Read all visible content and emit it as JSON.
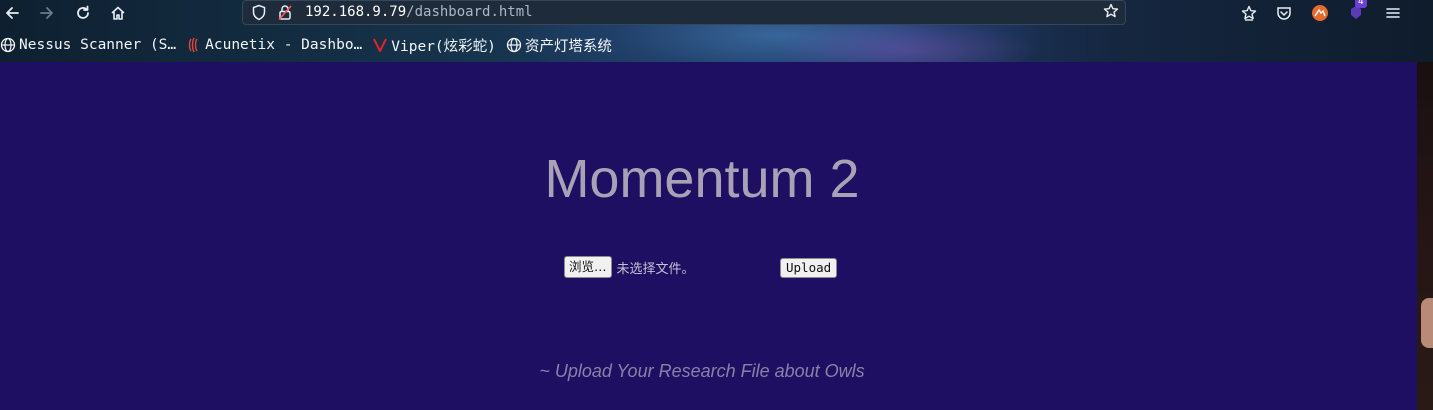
{
  "browser": {
    "url_host": "192.168.9.79",
    "url_path": "/dashboard.html",
    "extensions_badge": "4",
    "icons": [
      "back-arrow-icon",
      "forward-arrow-icon",
      "reload-icon",
      "home-icon",
      "shield-icon",
      "lock-icon",
      "star-icon",
      "save-to-pocket-icon",
      "pocket-icon",
      "extension-icon",
      "hamburger-menu-icon"
    ]
  },
  "bookmarks": [
    {
      "label": "Nessus Scanner (S…",
      "icon": "globe-icon"
    },
    {
      "label": "Acunetix - Dashbo…",
      "icon": "acunetix-icon"
    },
    {
      "label": "Viper(炫彩蛇)",
      "icon": "viper-icon"
    },
    {
      "label": "资产灯塔系统",
      "icon": "globe-icon"
    }
  ],
  "page": {
    "title": "Momentum 2",
    "browse_button": "浏览…",
    "file_status": "未选择文件。",
    "upload_button": "Upload",
    "caption": "~ Upload Your Research File about Owls"
  },
  "colors": {
    "page_background": "#1f0f63",
    "title": "#a9a2b6",
    "caption": "#8a80a8"
  }
}
